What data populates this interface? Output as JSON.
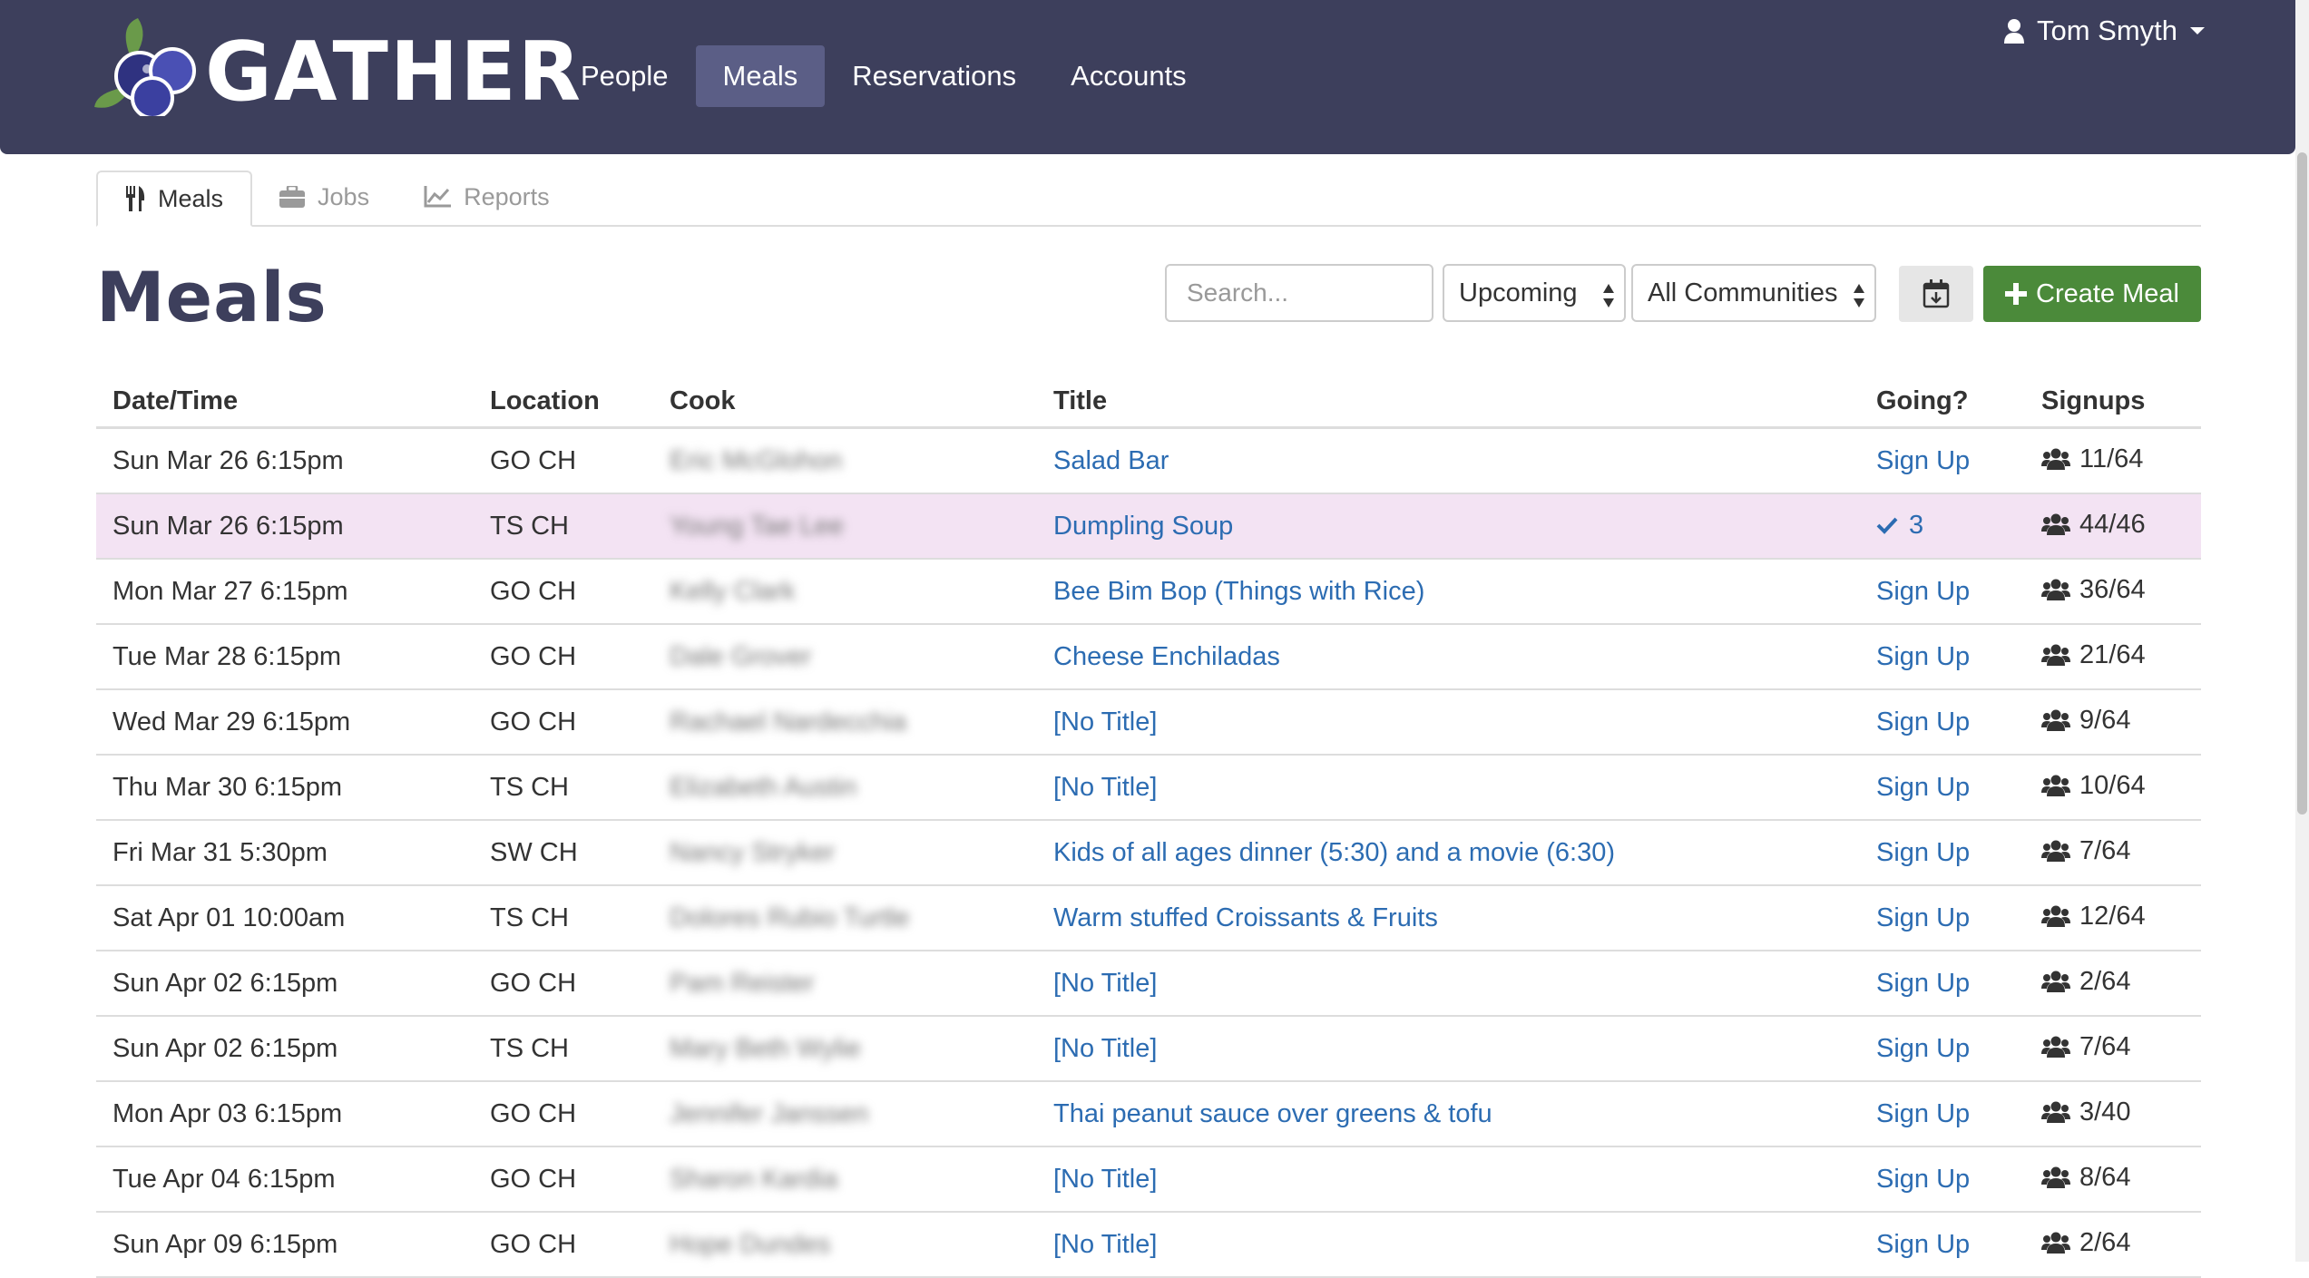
{
  "app": {
    "brand": "GATHER",
    "nav": [
      "People",
      "Meals",
      "Reservations",
      "Accounts"
    ],
    "active_nav": "Meals",
    "user_name": "Tom Smyth"
  },
  "subtabs": [
    {
      "label": "Meals",
      "icon": "cutlery-icon",
      "active": true
    },
    {
      "label": "Jobs",
      "icon": "briefcase-icon",
      "active": false
    },
    {
      "label": "Reports",
      "icon": "chart-line-icon",
      "active": false
    }
  ],
  "page": {
    "title": "Meals",
    "search_placeholder": "Search...",
    "time_filter": "Upcoming",
    "community_filter": "All Communities",
    "create_label": "Create Meal"
  },
  "table": {
    "headers": [
      "Date/Time",
      "Location",
      "Cook",
      "Title",
      "Going?",
      "Signups"
    ],
    "rows": [
      {
        "date": "Sun Mar 26 6:15pm",
        "location": "GO CH",
        "cook": "Eric McGlohon",
        "title": "Salad Bar",
        "going": "Sign Up",
        "signups": "11/64"
      },
      {
        "date": "Sun Mar 26 6:15pm",
        "location": "TS CH",
        "cook": "Young Tae Lee",
        "title": "Dumpling Soup",
        "going": "3",
        "signed_up": true,
        "signups": "44/46"
      },
      {
        "date": "Mon Mar 27 6:15pm",
        "location": "GO CH",
        "cook": "Kelly Clark",
        "title": "Bee Bim Bop (Things with Rice)",
        "going": "Sign Up",
        "signups": "36/64"
      },
      {
        "date": "Tue Mar 28 6:15pm",
        "location": "GO CH",
        "cook": "Dale Grover",
        "title": "Cheese Enchiladas",
        "going": "Sign Up",
        "signups": "21/64"
      },
      {
        "date": "Wed Mar 29 6:15pm",
        "location": "GO CH",
        "cook": "Rachael Nardecchia",
        "title": "[No Title]",
        "going": "Sign Up",
        "signups": "9/64"
      },
      {
        "date": "Thu Mar 30 6:15pm",
        "location": "TS CH",
        "cook": "Elizabeth Austin",
        "title": "[No Title]",
        "going": "Sign Up",
        "signups": "10/64"
      },
      {
        "date": "Fri Mar 31 5:30pm",
        "location": "SW CH",
        "cook": "Nancy Stryker",
        "title": "Kids of all ages dinner (5:30) and a movie (6:30)",
        "going": "Sign Up",
        "signups": "7/64"
      },
      {
        "date": "Sat Apr 01 10:00am",
        "location": "TS CH",
        "cook": "Dolores Rubio Turtle",
        "title": "Warm stuffed Croissants & Fruits",
        "going": "Sign Up",
        "signups": "12/64"
      },
      {
        "date": "Sun Apr 02 6:15pm",
        "location": "GO CH",
        "cook": "Pam Reister",
        "title": "[No Title]",
        "going": "Sign Up",
        "signups": "2/64"
      },
      {
        "date": "Sun Apr 02 6:15pm",
        "location": "TS CH",
        "cook": "Mary Beth Wylie",
        "title": "[No Title]",
        "going": "Sign Up",
        "signups": "7/64"
      },
      {
        "date": "Mon Apr 03 6:15pm",
        "location": "GO CH",
        "cook": "Jennifer Janssen",
        "title": "Thai peanut sauce over greens & tofu",
        "going": "Sign Up",
        "signups": "3/40"
      },
      {
        "date": "Tue Apr 04 6:15pm",
        "location": "GO CH",
        "cook": "Sharon Kardia",
        "title": "[No Title]",
        "going": "Sign Up",
        "signups": "8/64"
      },
      {
        "date": "Sun Apr 09 6:15pm",
        "location": "GO CH",
        "cook": "Hope Dundes",
        "title": "[No Title]",
        "going": "Sign Up",
        "signups": "2/64"
      }
    ]
  },
  "colors": {
    "navbar": "#3d3f5c",
    "nav_active": "#5b5e86",
    "link": "#2c6cb2",
    "create_button": "#4b8a3a",
    "highlight_row": "#f3e3f3"
  }
}
